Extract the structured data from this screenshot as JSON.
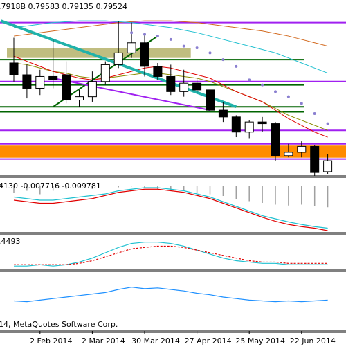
{
  "header": {
    "ohlc_text": ".7918B 0.79583 0.79135 0.79524"
  },
  "footer": {
    "copyright_text": "14, MetaQuotes Software Corp."
  },
  "colors": {
    "background": "#ffffff",
    "frame": "#000000",
    "bull_candle": "#ffffff",
    "bear_candle": "#000000",
    "purple_line": "#a020f0",
    "green_line": "#006400",
    "teal_line": "#20b2aa",
    "olive_zone": "#b5b26a",
    "orange_zone": "#ff8c00",
    "ma_fast": "#e00000",
    "ma_slow": "#8b8b00",
    "ma_long": "#d2691e",
    "ma_cyan": "#20c0d0",
    "psar_dot": "#8a7fd0",
    "osc_cyan": "#20c0d0",
    "osc_red": "#e00000",
    "rsi_blue": "#1e90ff"
  },
  "chart_data": [
    {
      "type": "candlestick",
      "panel": "price",
      "x_labels": [
        "2 Feb 2014",
        "2 Mar 2014",
        "30 Mar 2014",
        "27 Apr 2014",
        "25 May 2014",
        "22 Jun 2014"
      ],
      "candles": [
        {
          "o": 0.84,
          "h": 0.855,
          "l": 0.829,
          "c": 0.833
        },
        {
          "o": 0.833,
          "h": 0.839,
          "l": 0.819,
          "c": 0.825
        },
        {
          "o": 0.825,
          "h": 0.836,
          "l": 0.821,
          "c": 0.832
        },
        {
          "o": 0.832,
          "h": 0.854,
          "l": 0.825,
          "c": 0.83
        },
        {
          "o": 0.833,
          "h": 0.841,
          "l": 0.816,
          "c": 0.818
        },
        {
          "o": 0.818,
          "h": 0.824,
          "l": 0.814,
          "c": 0.82
        },
        {
          "o": 0.82,
          "h": 0.835,
          "l": 0.817,
          "c": 0.829
        },
        {
          "o": 0.829,
          "h": 0.841,
          "l": 0.827,
          "c": 0.839
        },
        {
          "o": 0.839,
          "h": 0.865,
          "l": 0.837,
          "c": 0.846
        },
        {
          "o": 0.846,
          "h": 0.864,
          "l": 0.843,
          "c": 0.852
        },
        {
          "o": 0.852,
          "h": 0.858,
          "l": 0.832,
          "c": 0.838
        },
        {
          "o": 0.838,
          "h": 0.84,
          "l": 0.83,
          "c": 0.832
        },
        {
          "o": 0.832,
          "h": 0.839,
          "l": 0.821,
          "c": 0.823
        },
        {
          "o": 0.823,
          "h": 0.836,
          "l": 0.82,
          "c": 0.828
        },
        {
          "o": 0.828,
          "h": 0.831,
          "l": 0.822,
          "c": 0.824
        },
        {
          "o": 0.824,
          "h": 0.826,
          "l": 0.808,
          "c": 0.812
        },
        {
          "o": 0.812,
          "h": 0.817,
          "l": 0.805,
          "c": 0.808
        },
        {
          "o": 0.808,
          "h": 0.809,
          "l": 0.796,
          "c": 0.799
        },
        {
          "o": 0.799,
          "h": 0.806,
          "l": 0.795,
          "c": 0.805
        },
        {
          "o": 0.805,
          "h": 0.808,
          "l": 0.799,
          "c": 0.804
        },
        {
          "o": 0.804,
          "h": 0.805,
          "l": 0.782,
          "c": 0.785
        },
        {
          "o": 0.785,
          "h": 0.792,
          "l": 0.784,
          "c": 0.787
        },
        {
          "o": 0.787,
          "h": 0.7935,
          "l": 0.784,
          "c": 0.7905
        },
        {
          "o": 0.7905,
          "h": 0.7915,
          "l": 0.773,
          "c": 0.775
        },
        {
          "o": 0.7755,
          "h": 0.786,
          "l": 0.774,
          "c": 0.782
        }
      ],
      "horizontal_levels": [
        {
          "kind": "purple",
          "value": 0.864
        },
        {
          "kind": "green",
          "value": 0.842
        },
        {
          "kind": "purple",
          "value": 0.829
        },
        {
          "kind": "green",
          "value": 0.827
        },
        {
          "kind": "green",
          "value": 0.814
        },
        {
          "kind": "green",
          "value": 0.811
        },
        {
          "kind": "purple",
          "value": 0.8
        },
        {
          "kind": "purple",
          "value": 0.792
        },
        {
          "kind": "purple",
          "value": 0.783
        }
      ],
      "zones": [
        {
          "kind": "olive",
          "from": 0.843,
          "to": 0.849,
          "start": 0,
          "end": 13
        },
        {
          "kind": "orange",
          "from": 0.7838,
          "to": 0.791,
          "start": -1,
          "end": 25
        }
      ],
      "trendlines": [
        {
          "kind": "teal",
          "p1": [
            -1,
            0.865
          ],
          "p2": [
            17,
            0.814
          ]
        },
        {
          "kind": "green",
          "p1": [
            3,
            0.814
          ],
          "p2": [
            11,
            0.856
          ]
        },
        {
          "kind": "purple",
          "p1": [
            3,
            0.831
          ],
          "p2": [
            15,
            0.812
          ]
        }
      ],
      "ma_fast": [
        0.844,
        0.841,
        0.838,
        0.835,
        0.833,
        0.831,
        0.83,
        0.831,
        0.833,
        0.835,
        0.837,
        0.838,
        0.837,
        0.835,
        0.833,
        0.831,
        0.827,
        0.823,
        0.82,
        0.817,
        0.812,
        0.807,
        0.803,
        0.799,
        0.796
      ],
      "ma_slow": [
        0.84,
        0.839,
        0.837,
        0.835,
        0.834,
        0.832,
        0.831,
        0.831,
        0.832,
        0.833,
        0.834,
        0.834,
        0.833,
        0.832,
        0.831,
        0.829,
        0.826,
        0.823,
        0.82,
        0.817,
        0.813,
        0.809,
        0.806,
        0.803,
        0.8
      ],
      "ma_long": [
        0.856,
        0.857,
        0.858,
        0.859,
        0.86,
        0.861,
        0.862,
        0.863,
        0.864,
        0.8645,
        0.865,
        0.865,
        0.865,
        0.8645,
        0.864,
        0.863,
        0.862,
        0.861,
        0.86,
        0.859,
        0.8575,
        0.856,
        0.854,
        0.852,
        0.85
      ],
      "ma_cyan": [
        0.861,
        0.862,
        0.863,
        0.864,
        0.8645,
        0.865,
        0.865,
        0.865,
        0.8645,
        0.864,
        0.863,
        0.862,
        0.861,
        0.8595,
        0.858,
        0.856,
        0.854,
        0.852,
        0.85,
        0.848,
        0.846,
        0.843,
        0.84,
        0.837,
        0.834
      ],
      "psar": [
        null,
        null,
        null,
        null,
        null,
        null,
        null,
        null,
        null,
        0.858,
        0.857,
        0.856,
        0.854,
        0.85,
        0.849,
        0.846,
        0.842,
        0.838,
        0.83,
        0.827,
        0.823,
        0.82,
        0.816,
        0.81,
        0.804
      ],
      "y_range": [
        0.773,
        0.87
      ]
    },
    {
      "type": "histogram_line",
      "panel": "oscillator",
      "header_values": "4130 -0.007716 -0.009781",
      "bars": [
        -0.004,
        -0.003,
        -0.005,
        -0.003,
        -0.002,
        -0.001,
        -0.002,
        0.0,
        0.001,
        0.0005,
        -0.001,
        -0.002,
        -0.0025,
        -0.003,
        -0.004,
        -0.005,
        -0.006,
        -0.008,
        -0.009,
        -0.01,
        -0.011,
        -0.0115,
        -0.011,
        -0.012,
        -0.0125
      ],
      "signal_cyan": [
        -0.003,
        -0.0035,
        -0.004,
        -0.004,
        -0.0035,
        -0.003,
        -0.0025,
        -0.002,
        -0.001,
        -0.0005,
        0.0,
        0.0,
        -0.0005,
        -0.001,
        -0.002,
        -0.003,
        -0.0045,
        -0.006,
        -0.0075,
        -0.009,
        -0.01,
        -0.011,
        -0.0118,
        -0.0125,
        -0.013
      ],
      "signal_red": [
        -0.004,
        -0.0045,
        -0.005,
        -0.005,
        -0.0045,
        -0.004,
        -0.0035,
        -0.0025,
        -0.0015,
        -0.001,
        -0.0005,
        -0.0005,
        -0.001,
        -0.0015,
        -0.0025,
        -0.0035,
        -0.005,
        -0.0065,
        -0.008,
        -0.0095,
        -0.0108,
        -0.0118,
        -0.0125,
        -0.013,
        -0.0138
      ],
      "y_range": [
        -0.014,
        0.002
      ]
    },
    {
      "type": "line",
      "panel": "indicator",
      "header_values": ".4493",
      "cyan": [
        0.3,
        0.3,
        0.31,
        0.3,
        0.31,
        0.33,
        0.36,
        0.4,
        0.44,
        0.47,
        0.48,
        0.48,
        0.47,
        0.45,
        0.42,
        0.39,
        0.36,
        0.34,
        0.33,
        0.32,
        0.32,
        0.31,
        0.31,
        0.31,
        0.31
      ],
      "red_dashed": [
        0.31,
        0.31,
        0.31,
        0.31,
        0.31,
        0.32,
        0.34,
        0.37,
        0.4,
        0.43,
        0.44,
        0.45,
        0.45,
        0.44,
        0.42,
        0.4,
        0.38,
        0.36,
        0.34,
        0.33,
        0.33,
        0.32,
        0.32,
        0.32,
        0.32
      ],
      "y_range": [
        0.28,
        0.52
      ]
    },
    {
      "type": "line",
      "panel": "indicator2",
      "blue": [
        45,
        44,
        46,
        48,
        50,
        52,
        54,
        56,
        60,
        63,
        61,
        62,
        60,
        58,
        55,
        53,
        50,
        48,
        46,
        45,
        44,
        45,
        44,
        45,
        46
      ],
      "y_range": [
        20,
        80
      ]
    }
  ]
}
